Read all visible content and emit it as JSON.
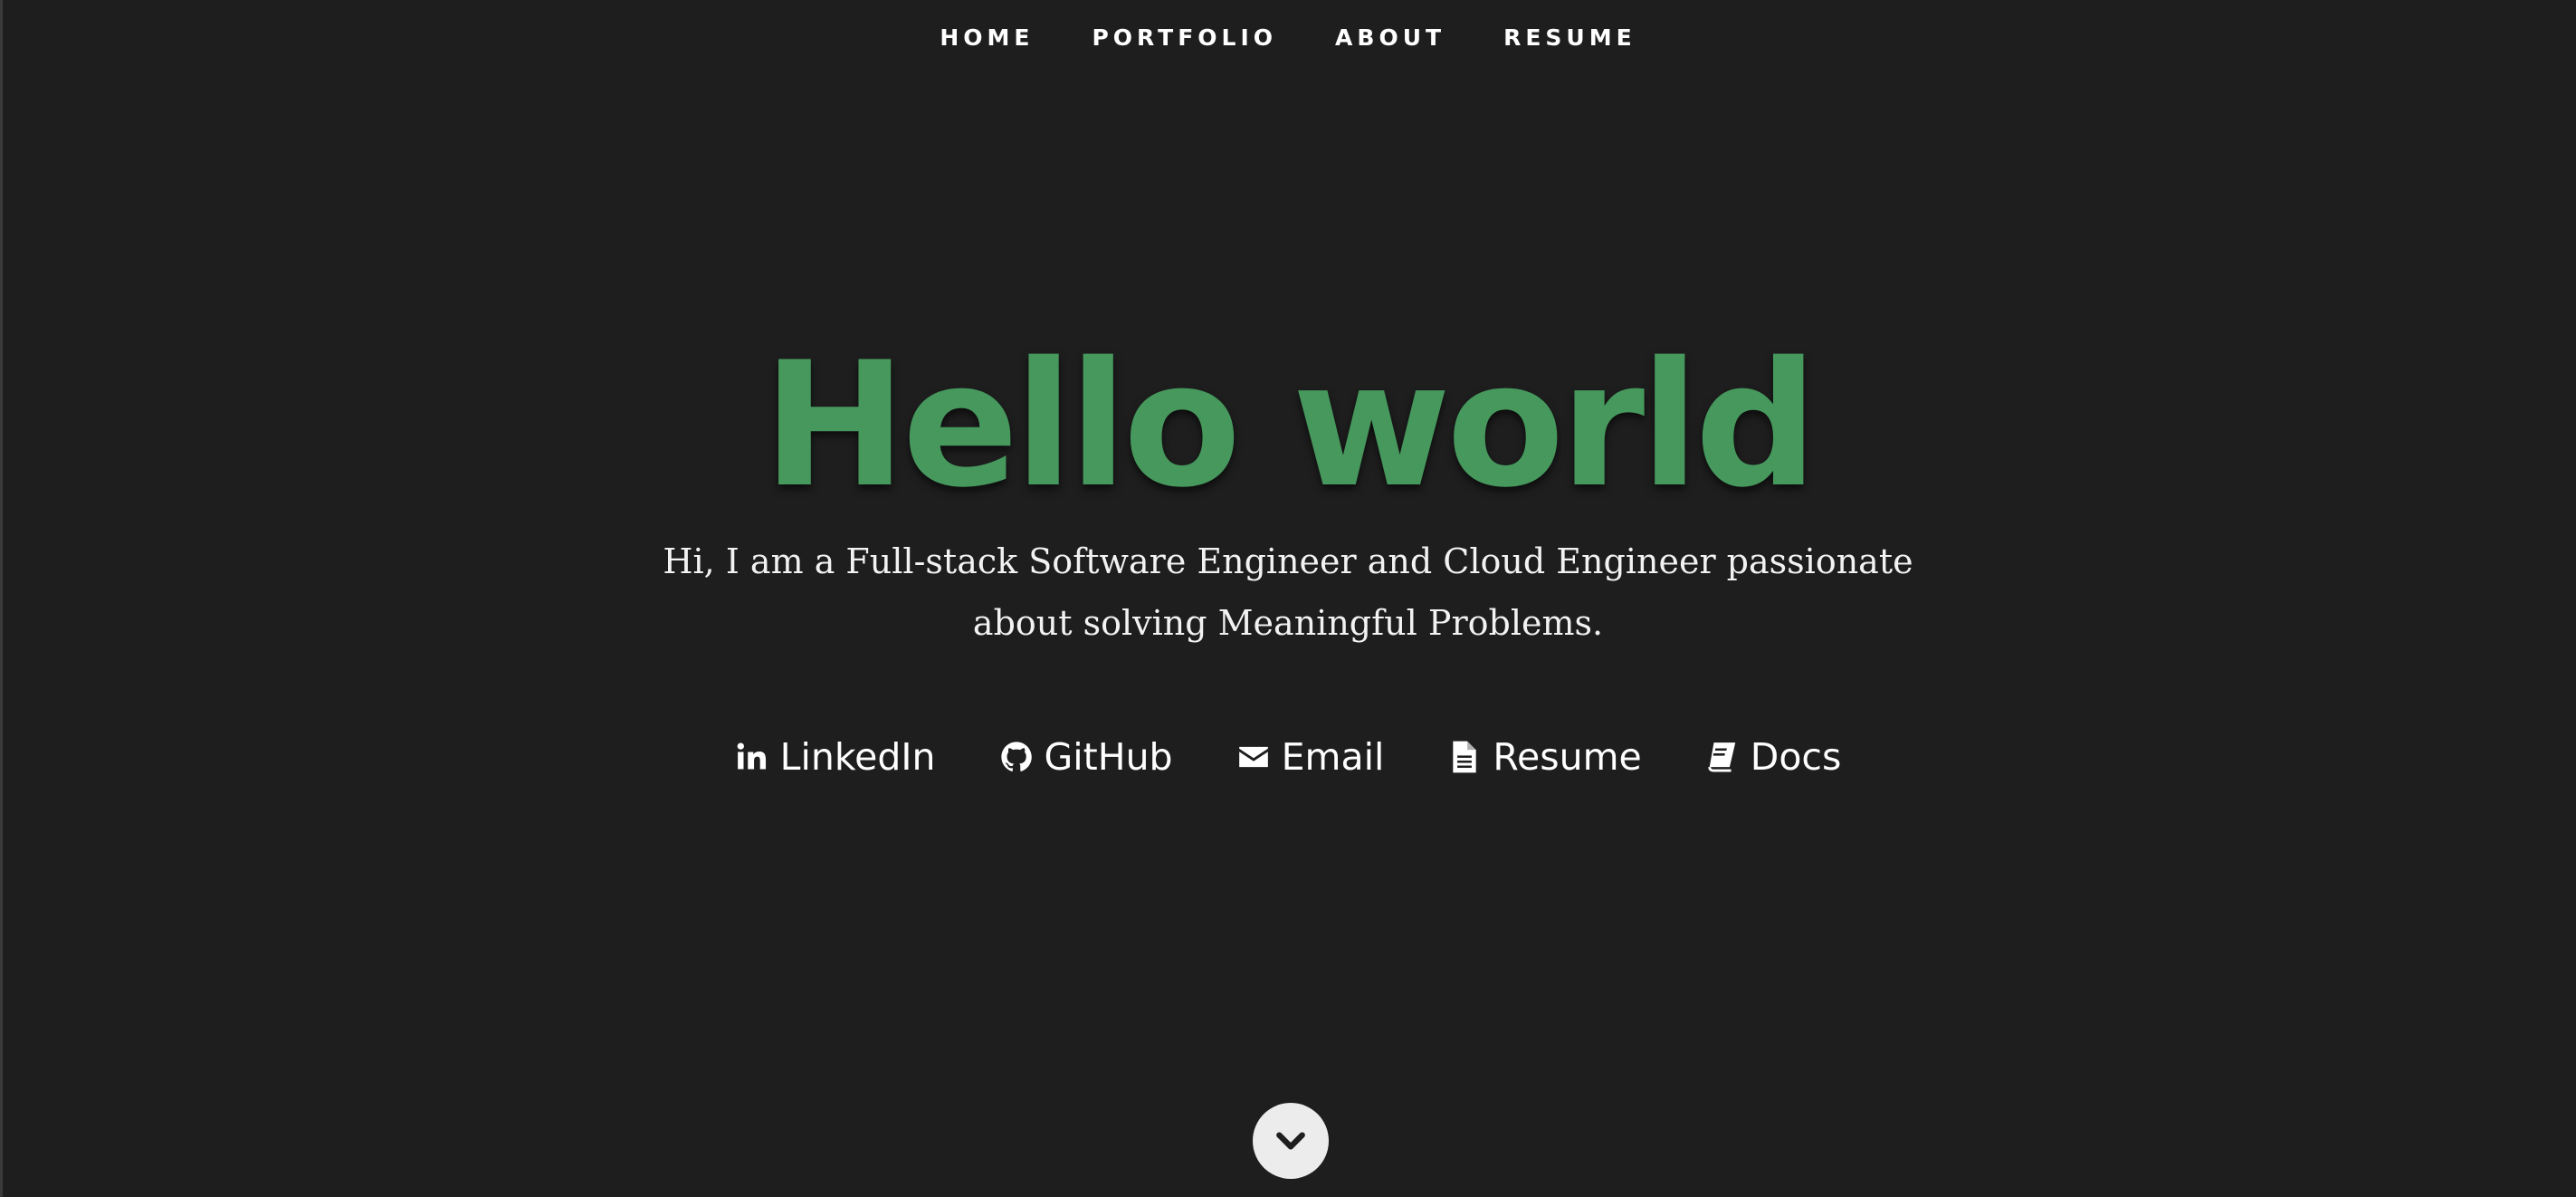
{
  "nav": {
    "items": [
      {
        "label": "HOME"
      },
      {
        "label": "PORTFOLIO"
      },
      {
        "label": "ABOUT"
      },
      {
        "label": "RESUME"
      }
    ]
  },
  "hero": {
    "title": "Hello world",
    "subtitle": "Hi, I am a Full-stack Software Engineer and Cloud Engineer passionate about solving Meaningful Problems."
  },
  "social": {
    "links": [
      {
        "label": "LinkedIn",
        "icon": "linkedin-icon"
      },
      {
        "label": "GitHub",
        "icon": "github-icon"
      },
      {
        "label": "Email",
        "icon": "envelope-icon"
      },
      {
        "label": "Resume",
        "icon": "document-icon"
      },
      {
        "label": "Docs",
        "icon": "book-icon"
      }
    ]
  },
  "scroll_down": {
    "icon": "chevron-down-icon"
  },
  "colors": {
    "background": "#1e1e1e",
    "accent": "#46985d",
    "text": "#ffffff",
    "scroll_button": "#ececec"
  }
}
